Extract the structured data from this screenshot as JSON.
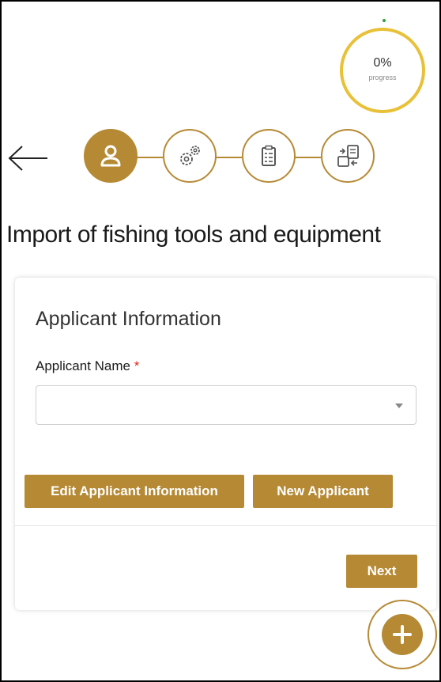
{
  "progress": {
    "value_percent": 0,
    "percent_text": "0%",
    "label": "progress"
  },
  "navigation": {
    "back_icon": "arrow-left-icon"
  },
  "steps": [
    {
      "icon": "user-icon",
      "state": "active"
    },
    {
      "icon": "gears-icon",
      "state": "inactive"
    },
    {
      "icon": "document-list-icon",
      "state": "inactive"
    },
    {
      "icon": "file-transfer-icon",
      "state": "inactive"
    }
  ],
  "page": {
    "title": "Import of fishing tools and equipment"
  },
  "form": {
    "section_title": "Applicant Information",
    "applicant_name": {
      "label": "Applicant Name",
      "required_mark": "*",
      "value": ""
    }
  },
  "actions": {
    "edit_label": "Edit Applicant Information",
    "new_label": "New Applicant",
    "next_label": "Next"
  },
  "fab": {
    "icon": "plus-icon"
  },
  "colors": {
    "brand": "#b68a35",
    "progress_ring": "#e8c138",
    "required": "#e2231a"
  }
}
